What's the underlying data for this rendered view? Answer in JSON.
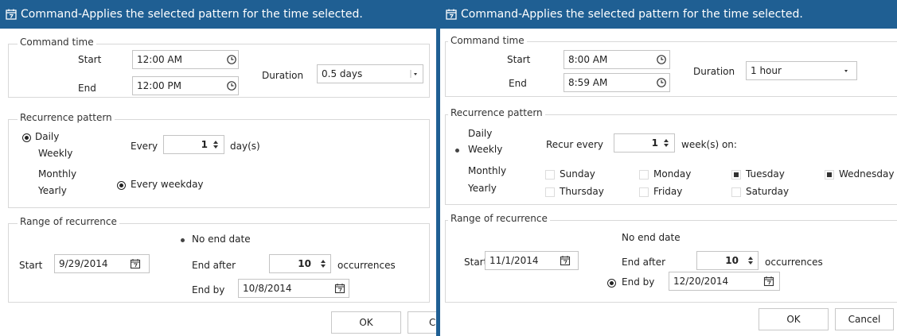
{
  "colors": {
    "title_bar": "#1f5f93",
    "title_text": "#ffffff",
    "section_border": "#d8d8d8"
  },
  "left": {
    "title": "Command-Applies the selected pattern for the time selected.",
    "command_time": {
      "section_label": "Command time",
      "start_label": "Start",
      "start_value": "12:00 AM",
      "end_label": "End",
      "end_value": "12:00 PM",
      "duration_label": "Duration",
      "duration_value": "0.5 days"
    },
    "recurrence": {
      "section_label": "Recurrence pattern",
      "options": [
        "Daily",
        "Weekly",
        "Monthly",
        "Yearly"
      ],
      "selected": "Daily",
      "every_label": "Every",
      "every_value": "1",
      "every_unit": "day(s)",
      "every_weekday_label": "Every weekday"
    },
    "range": {
      "section_label": "Range of recurrence",
      "start_label": "Start",
      "start_value": "9/29/2014",
      "no_end_label": "No end date",
      "end_after_label": "End after",
      "end_after_value": "10",
      "occurrences_label": "occurrences",
      "end_by_label": "End by",
      "end_by_value": "10/8/2014",
      "selected": "No end date"
    },
    "buttons": {
      "ok": "OK",
      "cancel_partial": "C"
    }
  },
  "right": {
    "title": "Command-Applies the selected pattern for the time selected.",
    "command_time": {
      "section_label": "Command time",
      "start_label": "Start",
      "start_value": "8:00 AM",
      "end_label": "End",
      "end_value": "8:59 AM",
      "duration_label": "Duration",
      "duration_value": "1 hour"
    },
    "recurrence": {
      "section_label": "Recurrence pattern",
      "options": [
        "Daily",
        "Weekly",
        "Monthly",
        "Yearly"
      ],
      "selected": "Weekly",
      "recur_label": "Recur every",
      "recur_value": "1",
      "recur_unit": "week(s) on:",
      "days": [
        {
          "label": "Sunday",
          "checked": false
        },
        {
          "label": "Monday",
          "checked": false
        },
        {
          "label": "Tuesday",
          "checked": true
        },
        {
          "label": "Wednesday",
          "checked": true
        },
        {
          "label": "Thursday",
          "checked": false
        },
        {
          "label": "Friday",
          "checked": false
        },
        {
          "label": "Saturday",
          "checked": false
        }
      ]
    },
    "range": {
      "section_label": "Range of recurrence",
      "start_label": "Start",
      "start_value": "11/1/2014",
      "no_end_label": "No end date",
      "end_after_label": "End after",
      "end_after_value": "10",
      "occurrences_label": "occurrences",
      "end_by_label": "End by",
      "end_by_value": "12/20/2014",
      "selected": "End by"
    },
    "buttons": {
      "ok": "OK",
      "cancel": "Cancel"
    }
  }
}
